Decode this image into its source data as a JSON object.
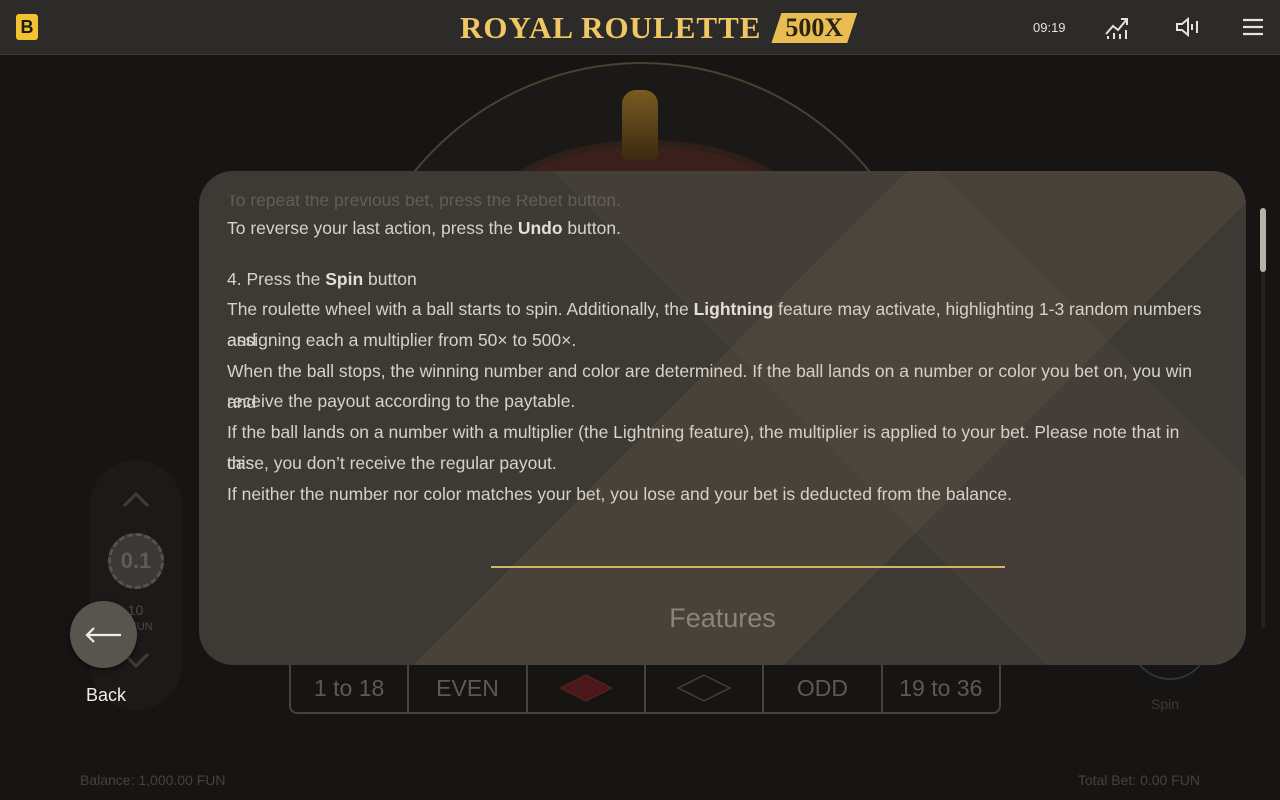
{
  "header": {
    "logo_letter": "B",
    "title": "ROYAL ROULETTE",
    "title_badge": "500X",
    "clock": "09:19",
    "icons": [
      "stats-chart-icon",
      "sound-icon",
      "menu-icon"
    ]
  },
  "game": {
    "bet_cells": [
      "1 to 18",
      "EVEN",
      "",
      "",
      "ODD",
      "19 to 36"
    ],
    "chip_value": "0.1",
    "chip_amount": "0.10",
    "chip_unit": "FUN",
    "spin_label": "Spin",
    "balance": "Balance: 1,000.00 FUN",
    "total_bet": "Total Bet: 0.00 FUN",
    "colors": {
      "red": "#8b1c1c",
      "black": "#1a1917"
    }
  },
  "modal": {
    "faded_line": "To repeat the previous bet, press the Rebet button.",
    "undo_pre": "To reverse your last action, press the ",
    "undo_bold": "Undo",
    "undo_post": " button.",
    "step4_pre": "4. Press the ",
    "step4_bold": "Spin",
    "step4_post": " button",
    "p1_pre": "The roulette wheel with a ball starts to spin. Additionally, the ",
    "p1_bold": "Lightning",
    "p1_post": " feature may activate, highlighting 1-3 random numbers and",
    "p1_line2": "assigning each a multiplier from 50× to 500×.",
    "p2_line1": "When the ball stops, the winning number and color are determined. If the ball lands on a number or color you bet on, you win and",
    "p2_line2": "receive the payout according to the paytable.",
    "p3_line1": "If the ball lands on a number with a multiplier (the Lightning feature), the multiplier is applied to your bet. Please note that in this",
    "p3_line2": "case, you don’t receive the regular payout.",
    "p4": "If neither the number nor color matches your bet, you lose and your bet is deducted from the balance.",
    "features_heading": "Features",
    "accent_color": "#d5b463"
  },
  "back": {
    "label": "Back"
  }
}
